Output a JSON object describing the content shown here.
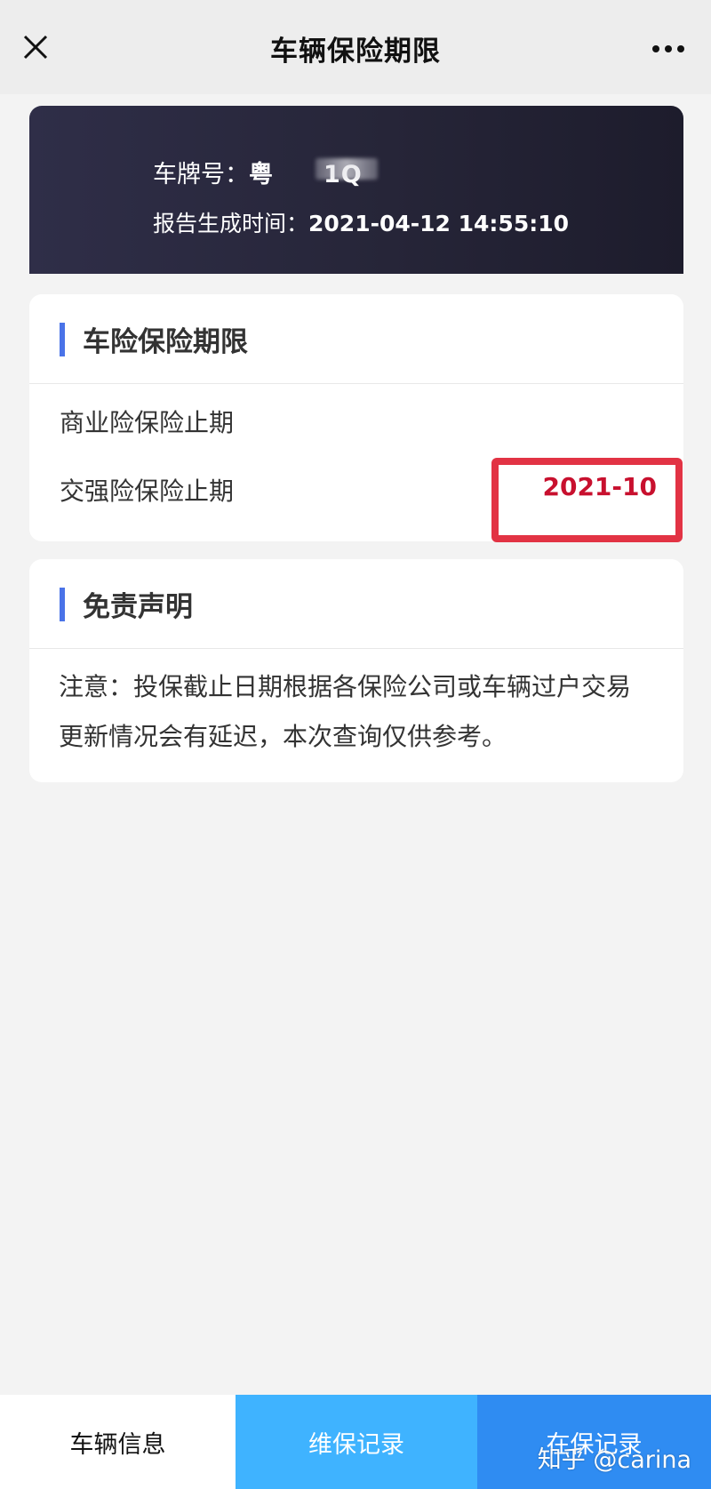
{
  "navbar": {
    "title": "车辆保险期限",
    "close_icon": "close-icon",
    "more_icon": "more-icon"
  },
  "header": {
    "plate_label": "车牌号：",
    "plate_value": "粤　　1Q",
    "time_label": "报告生成时间：",
    "time_value": "2021-04-12 14:55:10"
  },
  "insurance_card": {
    "title": "车险保险期限",
    "rows": [
      {
        "label": "商业险保险止期",
        "value": ""
      },
      {
        "label": "交强险保险止期",
        "value": "2021-10"
      }
    ]
  },
  "disclaimer_card": {
    "title": "免责声明",
    "text": "注意：投保截止日期根据各保险公司或车辆过户交易更新情况会有延迟，本次查询仅供参考。"
  },
  "tabbar": {
    "tabs": [
      {
        "label": "车辆信息"
      },
      {
        "label": "维保记录"
      },
      {
        "label": "在保记录"
      }
    ]
  },
  "watermark": "知乎 @carina",
  "colors": {
    "accent": "#4a73e8",
    "highlight": "#e23344",
    "value_red": "#c8102e",
    "tab_light_blue": "#3fb3ff",
    "tab_blue": "#2f8cf2"
  }
}
